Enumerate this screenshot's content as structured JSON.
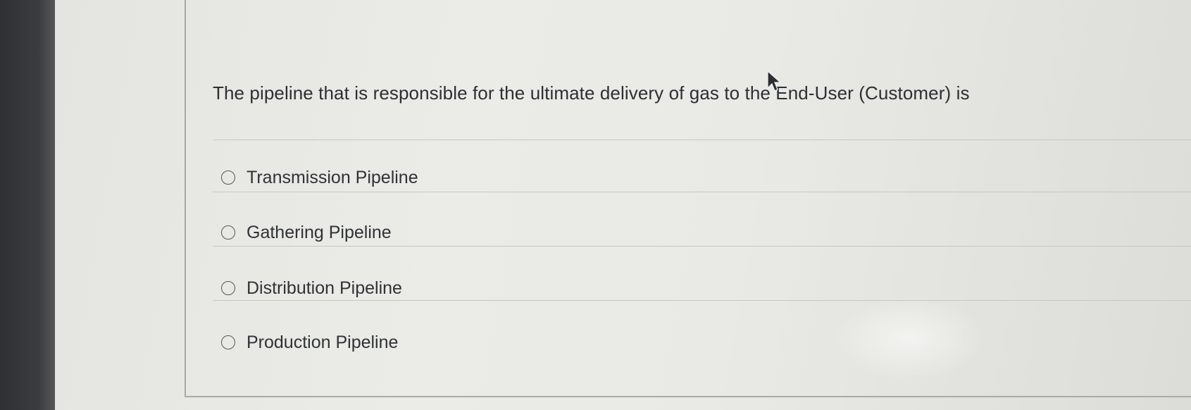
{
  "question": {
    "text": "The pipeline that is responsible for the ultimate delivery of gas to the End-User (Customer) is"
  },
  "options": [
    {
      "label": "Transmission Pipeline",
      "selected": false
    },
    {
      "label": "Gathering Pipeline",
      "selected": false
    },
    {
      "label": "Distribution Pipeline",
      "selected": false
    },
    {
      "label": "Production Pipeline",
      "selected": false
    }
  ],
  "icons": {
    "radio": "radio-unselected-icon",
    "cursor": "mouse-pointer-icon"
  }
}
